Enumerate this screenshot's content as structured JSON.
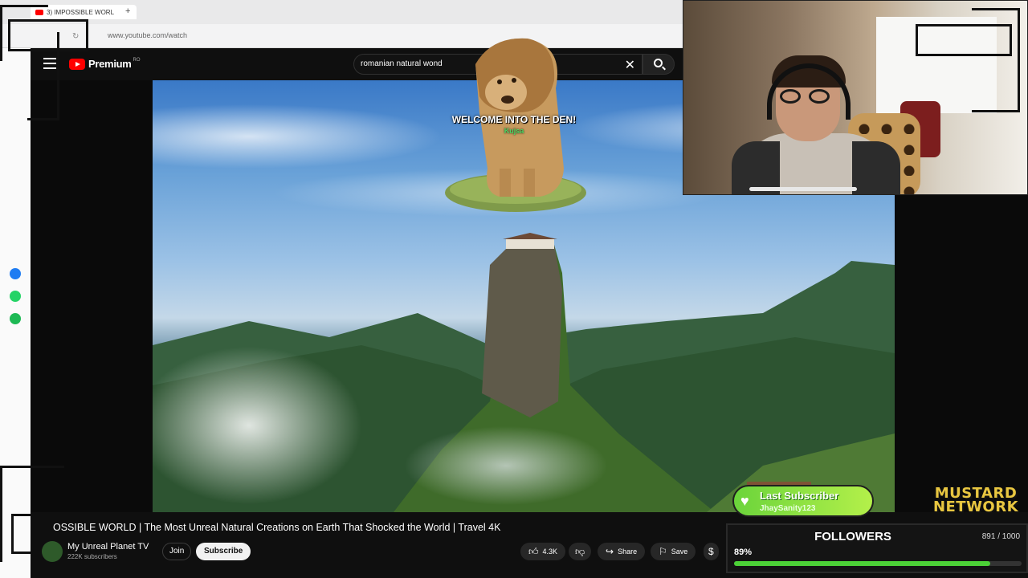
{
  "browser": {
    "tab_title": "3) IMPOSSIBLE WORL",
    "new_tab": "+",
    "url": "www.youtube.com/watch"
  },
  "youtube": {
    "logo_text": "Premium",
    "country": "RO",
    "search_value": "romanian natural wond",
    "search_clear": "✕"
  },
  "alert": {
    "title": "WELCOME INTO THE DEN!",
    "name": "Kujsa"
  },
  "video": {
    "title": "OSSIBLE WORLD | The Most Unreal Natural Creations on Earth That Shocked the World | Travel 4K",
    "channel": "My Unreal Planet TV",
    "subscribers": "222K subscribers",
    "join_label": "Join",
    "subscribe_label": "Subscribe",
    "likes": "4.3K",
    "share_label": "Share",
    "save_label": "Save"
  },
  "overlay": {
    "last_subscriber_label": "Last Subscriber",
    "last_subscriber_name": "JhaySanity123",
    "brand_line1": "MUSTARD",
    "brand_line2": "NETWORK",
    "followers_label": "FOLLOWERS",
    "followers_count": "891 / 1000",
    "followers_percent": "89%",
    "followers_progress": 0.891
  },
  "colors": {
    "youtube_red": "#ff0000",
    "progress_green": "#4cd137",
    "alert_green": "#4cd964",
    "brand_mustard": "#e8c640"
  }
}
